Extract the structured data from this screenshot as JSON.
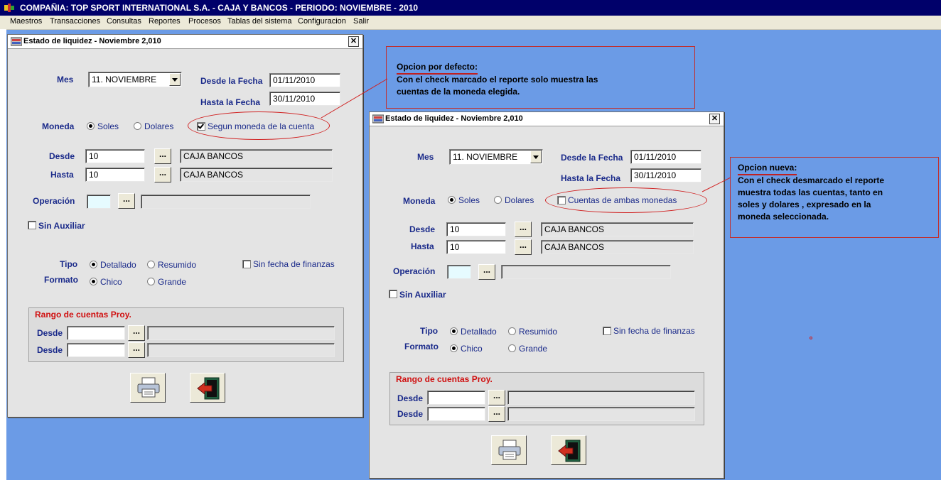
{
  "app": {
    "title": "COMPAÑIA:  TOP SPORT INTERNATIONAL S.A.   -   CAJA Y BANCOS   -   PERIODO: NOVIEMBRE - 2010",
    "menu": [
      "Maestros",
      "Transacciones",
      "Consultas",
      "Reportes",
      "Procesos",
      "Tablas del sistema",
      "Configuracion",
      "Salir"
    ]
  },
  "dialog": {
    "title": "Estado de liquidez - Noviembre 2,010",
    "close": "✕",
    "mes_label": "Mes",
    "mes_value": "11. NOVIEMBRE",
    "desde_fecha_label": "Desde la Fecha",
    "desde_fecha_value": "01/11/2010",
    "hasta_fecha_label": "Hasta la Fecha",
    "hasta_fecha_value": "30/11/2010",
    "moneda_label": "Moneda",
    "soles": "Soles",
    "dolares": "Dolares",
    "desde_label": "Desde",
    "hasta_label": "Hasta",
    "desde_code": "10",
    "desde_name": "CAJA BANCOS",
    "hasta_code": "10",
    "hasta_name": "CAJA BANCOS",
    "operacion_label": "Operación",
    "sin_auxiliar": "Sin Auxiliar",
    "tipo_label": "Tipo",
    "detallado": "Detallado",
    "resumido": "Resumido",
    "sin_fecha_finanzas": "Sin fecha de finanzas",
    "formato_label": "Formato",
    "chico": "Chico",
    "grande": "Grande",
    "rango_title": "Rango de cuentas Proy.",
    "ellipsis": "...",
    "check_left_label": "Segun moneda de la cuenta",
    "check_right_label": "Cuentas de ambas monedas"
  },
  "notes": {
    "left_heading": "Opcion por defecto:",
    "left_line1": "Con el check marcado el reporte solo muestra las",
    "left_line2": "cuentas de la moneda elegida.",
    "right_heading": "Opcion nueva:",
    "right_line1": "Con el check desmarcado el reporte",
    "right_line2": "muestra todas las cuentas, tanto en",
    "right_line3": "soles y dolares , expresado en la",
    "right_line4": "moneda seleccionada."
  },
  "colors": {
    "desktop": "#6b9be6",
    "titlebar": "#00006a",
    "accent_red": "#d02020"
  },
  "icons": [
    "app-icon",
    "window-icon",
    "close-icon",
    "printer-icon",
    "exit-door-icon",
    "chevron-down-icon"
  ]
}
